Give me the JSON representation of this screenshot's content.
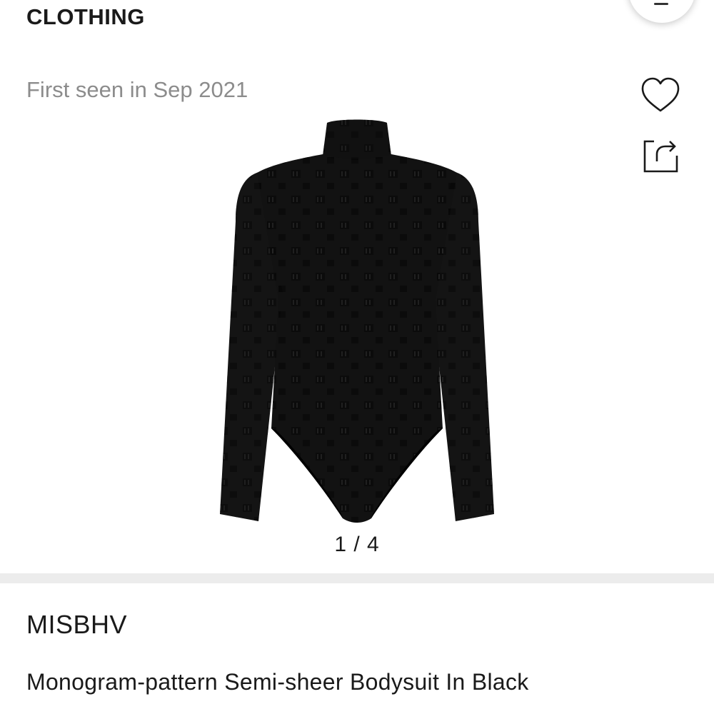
{
  "header": {
    "category": "CLOTHING"
  },
  "meta": {
    "first_seen": "First seen in Sep 2021"
  },
  "actions": {
    "favorite_icon": "heart-icon",
    "share_icon": "share-icon",
    "menu_icon": "menu-icon"
  },
  "gallery": {
    "pager": "1 / 4",
    "image_subject": "bodysuit"
  },
  "product": {
    "brand": "MISBHV",
    "name": "Monogram-pattern Semi-sheer Bodysuit In Black"
  },
  "colors": {
    "text": "#1a1a1a",
    "muted": "#8c8c8c",
    "divider": "#ececec",
    "garment": "#111111"
  }
}
